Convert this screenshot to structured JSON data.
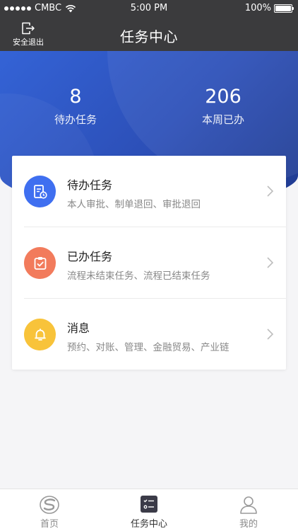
{
  "status_bar": {
    "carrier": "CMBC",
    "time": "5:00 PM",
    "battery": "100%"
  },
  "nav": {
    "logout_label": "安全退出",
    "title": "任务中心"
  },
  "stats": [
    {
      "value": "8",
      "label": "待办任务"
    },
    {
      "value": "206",
      "label": "本周已办"
    }
  ],
  "menu": [
    {
      "title": "待办任务",
      "subtitle": "本人审批、制单退回、审批退回",
      "icon": "todo-document-icon",
      "color": "#3f6ff0"
    },
    {
      "title": "已办任务",
      "subtitle": "流程未结束任务、流程已结束任务",
      "icon": "clipboard-check-icon",
      "color": "#f27b5c"
    },
    {
      "title": "消息",
      "subtitle": "预约、对账、管理、金融贸易、产业链",
      "icon": "bell-icon",
      "color": "#f8c33a"
    }
  ],
  "tabs": [
    {
      "label": "首页",
      "icon": "home-logo-icon",
      "active": false
    },
    {
      "label": "任务中心",
      "icon": "task-list-icon",
      "active": true
    },
    {
      "label": "我的",
      "icon": "user-icon",
      "active": false
    }
  ],
  "colors": {
    "topbar": "#3b3b3d",
    "hero": "#2c4fb7",
    "background": "#f5f5f7"
  }
}
